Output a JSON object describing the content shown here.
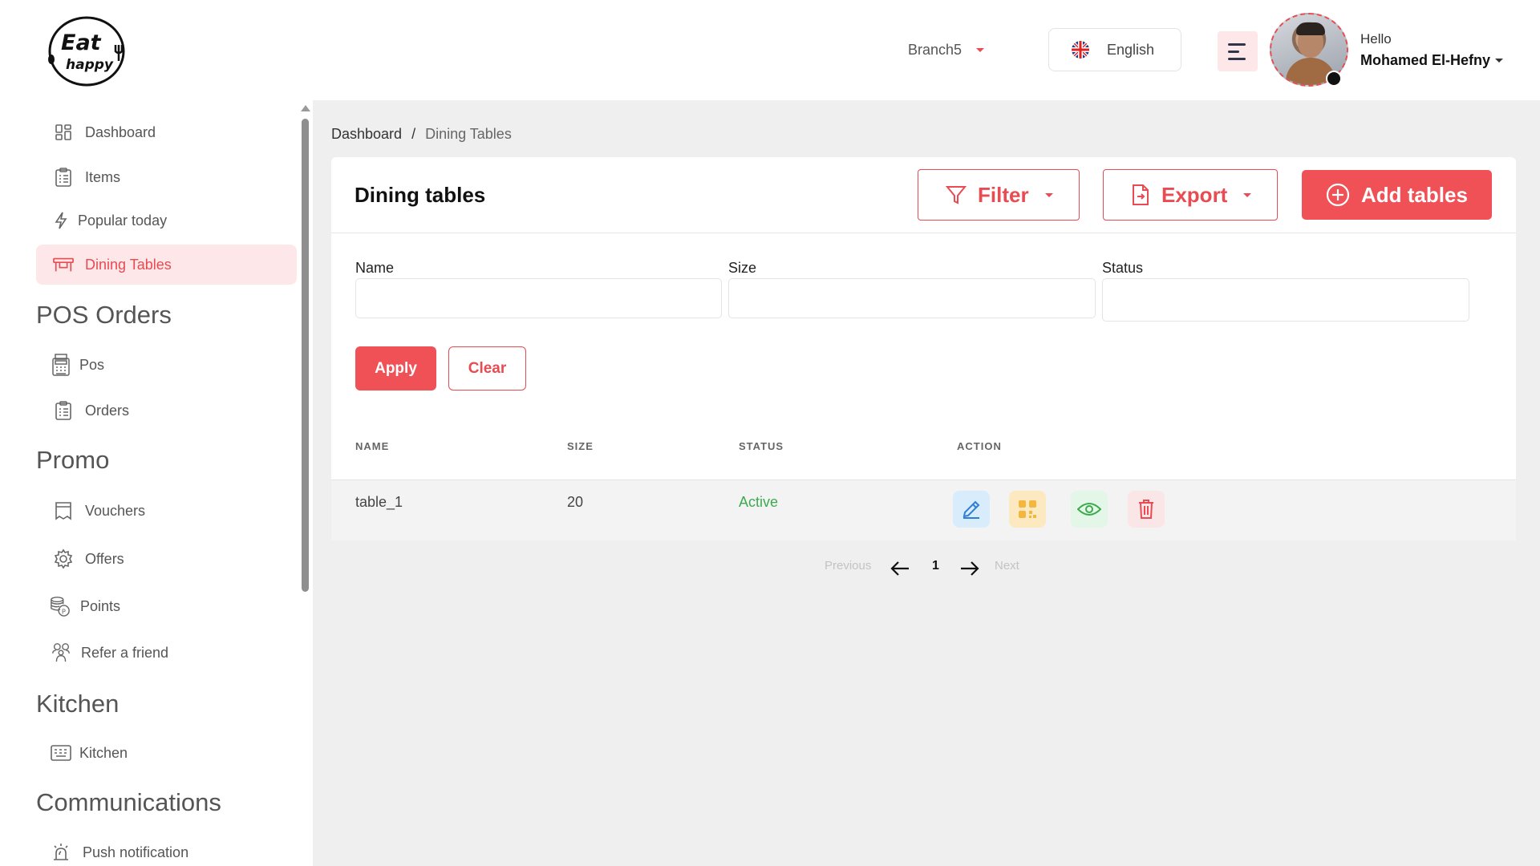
{
  "header": {
    "logo_text_1": "Eat",
    "logo_text_2": "happy",
    "branch": "Branch5",
    "language": "English",
    "greeting": "Hello",
    "user_name": "Mohamed El-Hefny"
  },
  "sidebar": {
    "items_top": [
      {
        "label": "Dashboard",
        "icon": "dashboard-icon"
      },
      {
        "label": "Items",
        "icon": "items-icon"
      },
      {
        "label": "Popular today",
        "icon": "lightning-icon"
      },
      {
        "label": "Dining Tables",
        "icon": "dining-table-icon",
        "active": true
      }
    ],
    "sections": [
      {
        "title": "POS Orders",
        "items": [
          {
            "label": "Pos",
            "icon": "pos-icon"
          },
          {
            "label": "Orders",
            "icon": "orders-icon"
          }
        ]
      },
      {
        "title": "Promo",
        "items": [
          {
            "label": "Vouchers",
            "icon": "voucher-icon"
          },
          {
            "label": "Offers",
            "icon": "offers-gear-icon"
          },
          {
            "label": "Points",
            "icon": "points-coins-icon"
          },
          {
            "label": "Refer a friend",
            "icon": "refer-friend-icon"
          }
        ]
      },
      {
        "title": "Kitchen",
        "items": [
          {
            "label": "Kitchen",
            "icon": "kitchen-icon"
          }
        ]
      },
      {
        "title": "Communications",
        "items": [
          {
            "label": "Push notification",
            "icon": "bell-alarm-icon"
          }
        ]
      }
    ]
  },
  "breadcrumb": {
    "root": "Dashboard",
    "separator": "/",
    "current": "Dining Tables"
  },
  "page": {
    "title": "Dining tables",
    "filter_label": "Filter",
    "export_label": "Export",
    "add_label": "Add tables"
  },
  "filters": {
    "name_label": "Name",
    "name_value": "",
    "size_label": "Size",
    "size_value": "",
    "status_label": "Status",
    "status_value": "",
    "apply_label": "Apply",
    "clear_label": "Clear"
  },
  "table": {
    "columns": [
      "NAME",
      "SIZE",
      "STATUS",
      "ACTION"
    ],
    "rows": [
      {
        "name": "table_1",
        "size": "20",
        "status": "Active"
      }
    ]
  },
  "pagination": {
    "previous": "Previous",
    "page": "1",
    "next": "Next"
  },
  "colors": {
    "accent": "#ef5156",
    "active_bg": "#fde7e8",
    "status_active": "#3daa4e"
  }
}
